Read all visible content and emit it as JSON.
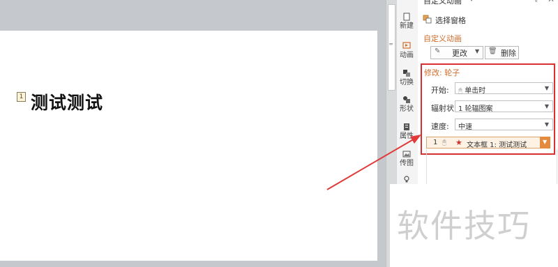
{
  "slide": {
    "marker": "1",
    "text": "测试测试"
  },
  "tabs": [
    {
      "label": "新建",
      "icon": "new-icon"
    },
    {
      "label": "动画",
      "icon": "animation-icon"
    },
    {
      "label": "切换",
      "icon": "transition-icon"
    },
    {
      "label": "形状",
      "icon": "shapes-icon"
    },
    {
      "label": "属性",
      "icon": "properties-icon"
    },
    {
      "label": "传图",
      "icon": "picture-icon"
    }
  ],
  "pane": {
    "title": "自定义动画",
    "select_pane_label": "选择窗格",
    "section_heading": "自定义动画",
    "modify_label": "更改",
    "delete_label": "删除",
    "edit_title": "修改: 轮子",
    "fields": {
      "start_label": "开始:",
      "start_value": "单击时",
      "spokes_label": "辐射状:",
      "spokes_value": "1 轮辐图案",
      "speed_label": "速度:",
      "speed_value": "中速"
    },
    "anim_item": {
      "number": "1",
      "text": "文本框 1: 测试测试"
    }
  },
  "watermark": "软件技巧",
  "colors": {
    "accent_orange": "#d26b2a",
    "highlight_red": "#d63030",
    "arrow_red": "#e03a3a",
    "star_red": "#d3302b"
  }
}
